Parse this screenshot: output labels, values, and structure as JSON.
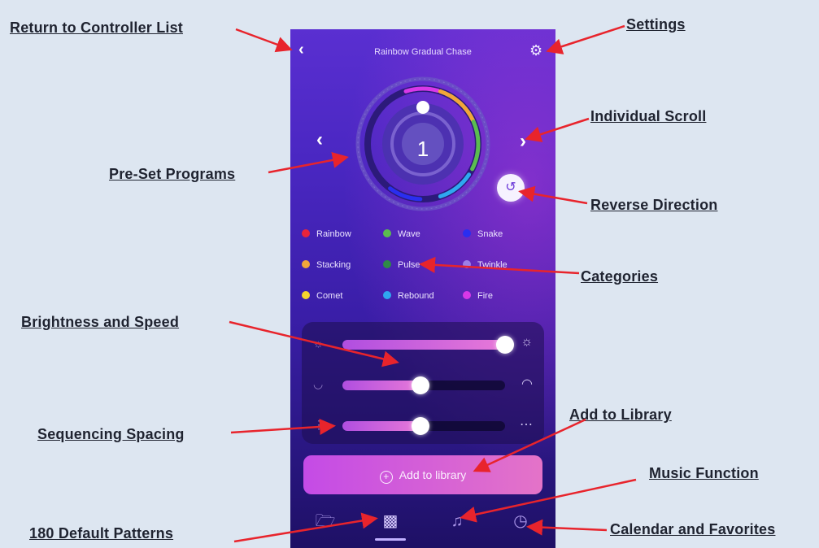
{
  "app": {
    "pattern_title": "Rainbow Gradual Chase",
    "program_number": "1",
    "icons": {
      "back": "chevron-left-icon",
      "settings": "gear-icon",
      "prev": "chevron-left-icon",
      "next": "chevron-right-icon",
      "reverse": "reverse-arrow-icon"
    }
  },
  "categories": [
    {
      "label": "Rainbow",
      "color": "#e8243c"
    },
    {
      "label": "Wave",
      "color": "#5bbd4f"
    },
    {
      "label": "Snake",
      "color": "#2a2ef0"
    },
    {
      "label": "Stacking",
      "color": "#f1a63a"
    },
    {
      "label": "Pulse",
      "color": "#2f8a47"
    },
    {
      "label": "Twinkle",
      "color": "#9c7fe8"
    },
    {
      "label": "Comet",
      "color": "#f5d42c"
    },
    {
      "label": "Rebound",
      "color": "#2fa8f0"
    },
    {
      "label": "Fire",
      "color": "#d838e8"
    }
  ],
  "sliders": [
    {
      "name": "brightness",
      "value": 1.0,
      "left_icon": "sun-dim-icon",
      "right_icon": "sun-icon"
    },
    {
      "name": "speed",
      "value": 0.48,
      "left_icon": "speed-slow-icon",
      "right_icon": "speed-fast-icon"
    },
    {
      "name": "spacing",
      "value": 0.48,
      "left_icon": "spacing-narrow-icon",
      "right_icon": "spacing-wide-icon"
    }
  ],
  "add_button": {
    "label": "Add to library"
  },
  "tabs": [
    {
      "icon": "folder-icon",
      "active": false
    },
    {
      "icon": "patterns-icon",
      "active": true
    },
    {
      "icon": "music-note-icon",
      "active": false
    },
    {
      "icon": "clock-icon",
      "active": false
    }
  ],
  "annotations": {
    "return_to_list": "Return to Controller List",
    "settings": "Settings",
    "individual_scroll": "Individual Scroll",
    "preset_programs": "Pre-Set Programs",
    "reverse_direction": "Reverse Direction",
    "categories": "Categories",
    "brightness_speed": "Brightness and Speed",
    "sequencing_spacing": "Sequencing Spacing",
    "add_to_library": "Add to Library",
    "music_function": "Music Function",
    "default_patterns": "180 Default Patterns",
    "calendar_favorites": "Calendar and Favorites"
  },
  "colors": {
    "annotation_arrow": "#e8242c",
    "phone_top": "#5a2fd1",
    "phone_bottom": "#1e1065"
  }
}
